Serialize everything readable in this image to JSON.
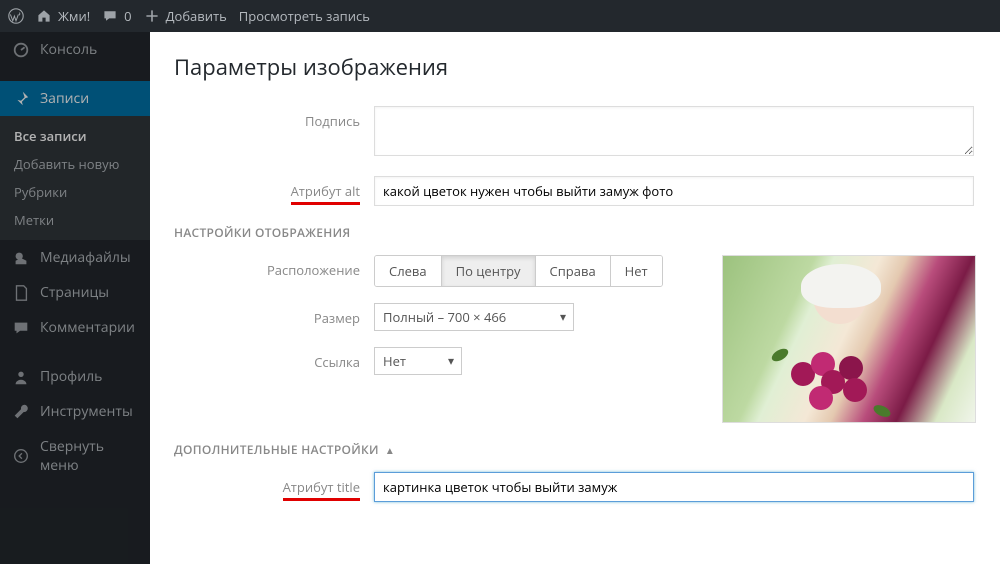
{
  "adminbar": {
    "site": "Жми!",
    "comments": "0",
    "add": "Добавить",
    "view_post": "Просмотреть запись"
  },
  "sidebar": {
    "console": "Консоль",
    "posts": "Записи",
    "posts_sub": {
      "all": "Все записи",
      "add": "Добавить новую",
      "categories": "Рубрики",
      "tags": "Метки"
    },
    "media": "Медиафайлы",
    "pages": "Страницы",
    "comments": "Комментарии",
    "profile": "Профиль",
    "tools": "Инструменты",
    "collapse": "Свернуть меню"
  },
  "modal": {
    "title": "Параметры изображения",
    "caption_label": "Подпись",
    "caption_value": "",
    "alt_label": "Атрибут alt",
    "alt_value": "какой цветок нужен чтобы выйти замуж фото",
    "display_section": "НАСТРОЙКИ ОТОБРАЖЕНИЯ",
    "align_label": "Расположение",
    "align_opts": {
      "left": "Слева",
      "center": "По центру",
      "right": "Справа",
      "none": "Нет"
    },
    "size_label": "Размер",
    "size_value": "Полный – 700 × 466",
    "link_label": "Ссылка",
    "link_value": "Нет",
    "adv_section": "ДОПОЛНИТЕЛЬНЫЕ НАСТРОЙКИ",
    "title_label": "Атрибут title",
    "title_value": "картинка цветок чтобы выйти замуж"
  }
}
